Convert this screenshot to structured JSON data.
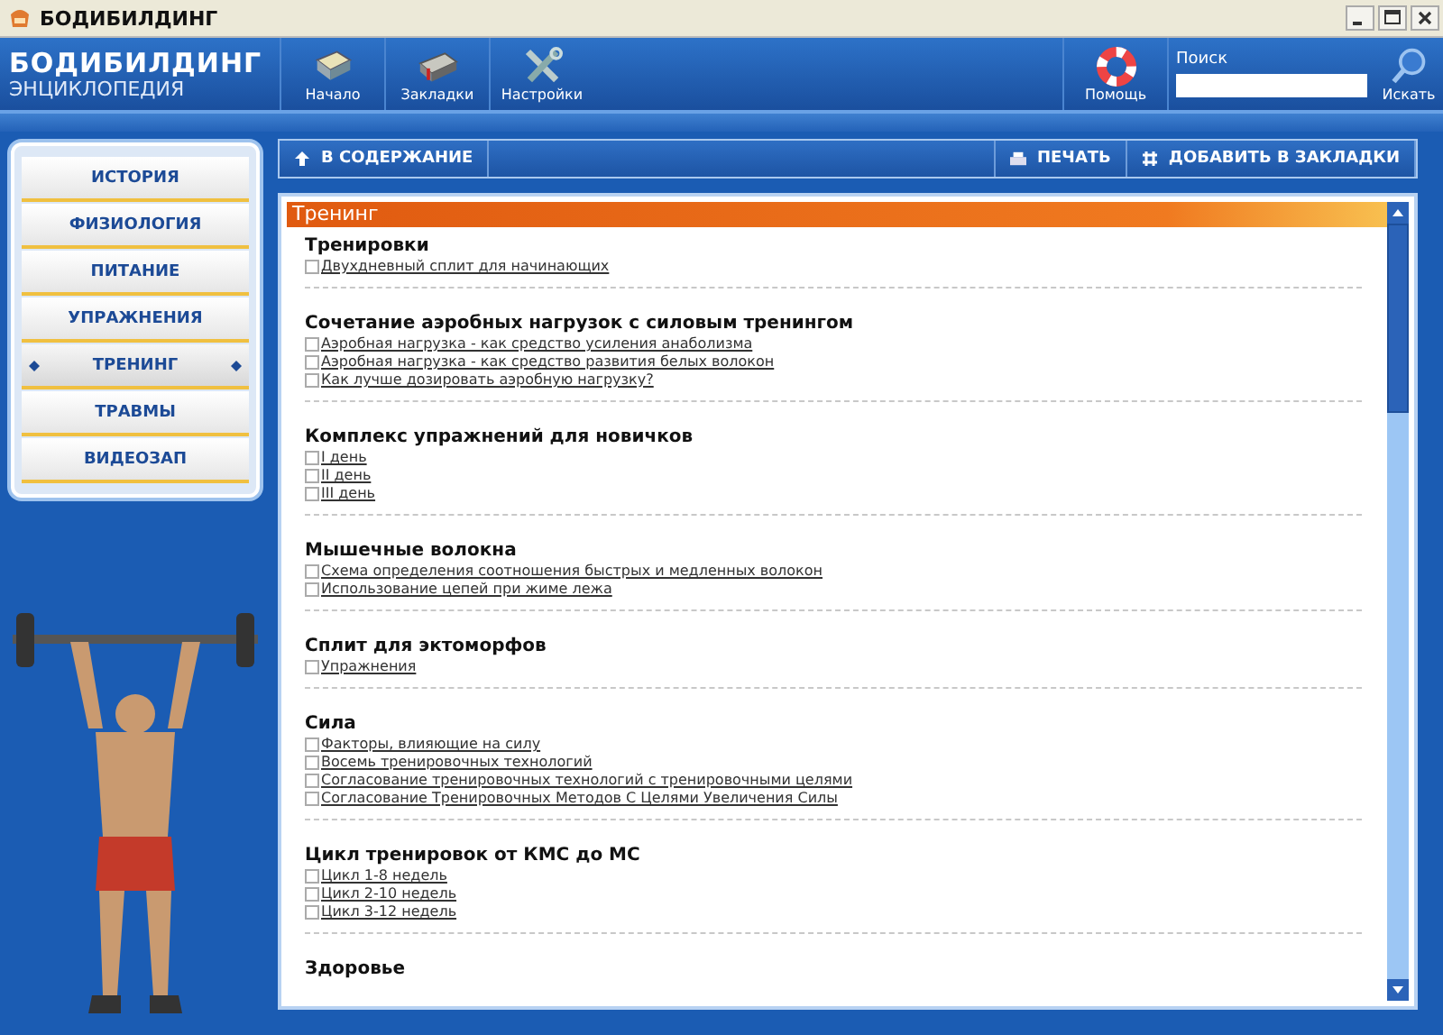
{
  "window": {
    "title": "БОДИБИЛДИНГ"
  },
  "header": {
    "logo_title": "БОДИБИЛДИНГ",
    "logo_subtitle": "ЭНЦИКЛОПЕДИЯ",
    "tools": [
      {
        "kind": "home",
        "label": "Начало"
      },
      {
        "kind": "bookmarks",
        "label": "Закладки"
      },
      {
        "kind": "settings",
        "label": "Настройки"
      }
    ],
    "help": {
      "kind": "help",
      "label": "Помощь"
    },
    "search": {
      "label": "Поиск",
      "button": "Искать"
    }
  },
  "sidebar": {
    "items": [
      {
        "label": "ИСТОРИЯ",
        "selected": false
      },
      {
        "label": "ФИЗИОЛОГИЯ",
        "selected": false
      },
      {
        "label": "ПИТАНИЕ",
        "selected": false
      },
      {
        "label": "УПРАЖНЕНИЯ",
        "selected": false
      },
      {
        "label": "ТРЕНИНГ",
        "selected": true
      },
      {
        "label": "ТРАВМЫ",
        "selected": false
      },
      {
        "label": "ВИДЕОЗАП",
        "selected": false
      }
    ]
  },
  "toolbar": {
    "back": "В СОДЕРЖАНИЕ",
    "print": "ПЕЧАТЬ",
    "bookmark": "ДОБАВИТЬ В ЗАКЛАДКИ"
  },
  "content": {
    "title": "Тренинг",
    "sections": [
      {
        "heading": "Тренировки",
        "links": [
          {
            "text": "Двухдневный сплит для начинающих",
            "checked": false
          }
        ]
      },
      {
        "heading": "Сочетание аэробных нагрузок с силовым тренингом",
        "links": [
          {
            "text": "Аэробная нагрузка - как средство усиления анаболизма",
            "checked": false
          },
          {
            "text": "Аэробная нагрузка - как средство развития белых волокон",
            "checked": false
          },
          {
            "text": "Как лучше дозировать аэробную нагрузку?",
            "checked": false
          }
        ]
      },
      {
        "heading": "Комплекс упражнений для новичков",
        "links": [
          {
            "text": "I день",
            "checked": false
          },
          {
            "text": "II день",
            "checked": false
          },
          {
            "text": "III день",
            "checked": false
          }
        ]
      },
      {
        "heading": "Мышечные волокна",
        "links": [
          {
            "text": "Схема определения соотношения быстрых и медленных волокон",
            "checked": false
          },
          {
            "text": "Использование цепей при жиме лежа",
            "checked": false
          }
        ]
      },
      {
        "heading": "Сплит для эктоморфов",
        "links": [
          {
            "text": "Упражнения",
            "checked": false
          }
        ]
      },
      {
        "heading": "Сила",
        "links": [
          {
            "text": "Факторы, влияющие на силу",
            "checked": false
          },
          {
            "text": "Восемь тренировочных технологий",
            "checked": false
          },
          {
            "text": "Согласование тренировочных технологий с тренировочными целями",
            "checked": false
          },
          {
            "text": "Согласование Тренировочных Методов С Целями Увеличения Силы",
            "checked": false
          }
        ]
      },
      {
        "heading": "Цикл тренировок от КМС до МС",
        "links": [
          {
            "text": "Цикл 1-8 недель",
            "checked": false
          },
          {
            "text": "Цикл 2-10 недель",
            "checked": false
          },
          {
            "text": "Цикл 3-12 недель",
            "checked": false
          }
        ]
      },
      {
        "heading": "Здоровье"
      }
    ]
  }
}
